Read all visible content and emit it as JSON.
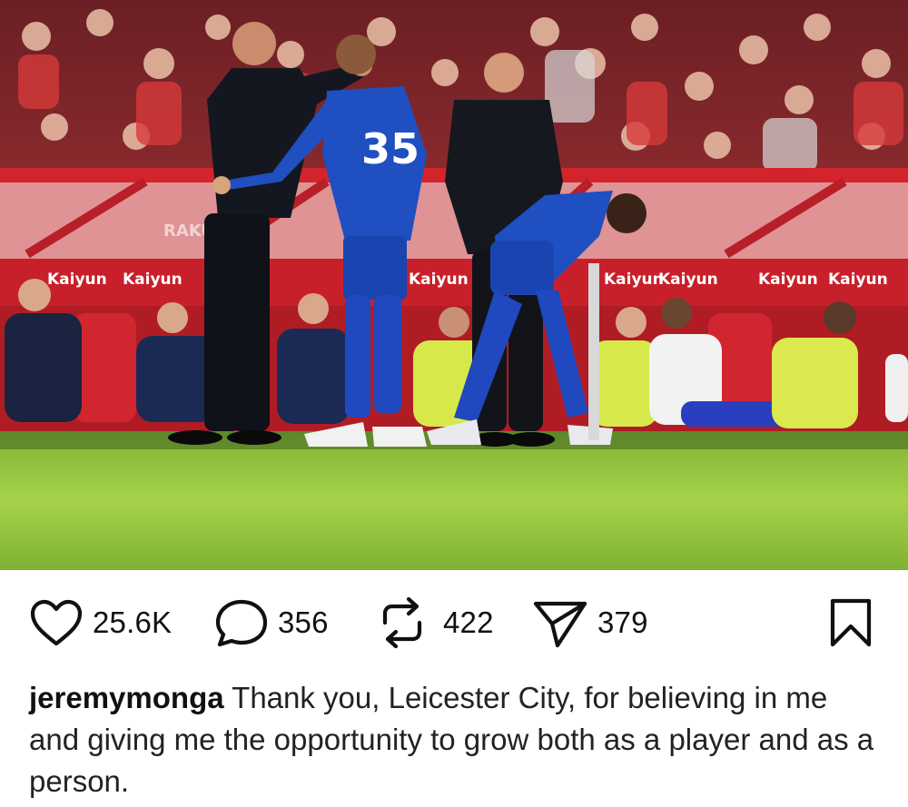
{
  "post": {
    "image_alt": "Leicester City player number 35 being substituted on at the touchline",
    "jersey_number": "35",
    "sponsor_text": "Kaiyun",
    "ad_board_left_text": "RAKUTEN"
  },
  "actions": {
    "likes": "25.6K",
    "comments": "356",
    "reposts": "422",
    "shares": "379"
  },
  "caption": {
    "username": "jeremymonga",
    "text": "Thank you, Leicester City, for believing in me and giving me the opportunity to grow both as a player and as a person."
  },
  "icons": {
    "like": "heart-icon",
    "comment": "comment-bubble-icon",
    "repost": "repost-arrows-icon",
    "share": "send-paperplane-icon",
    "save": "bookmark-icon"
  },
  "colors": {
    "pitch": "#8dc23a",
    "stand_red": "#c8202a",
    "leicester_blue": "#1f4fc0",
    "text": "#111111"
  }
}
